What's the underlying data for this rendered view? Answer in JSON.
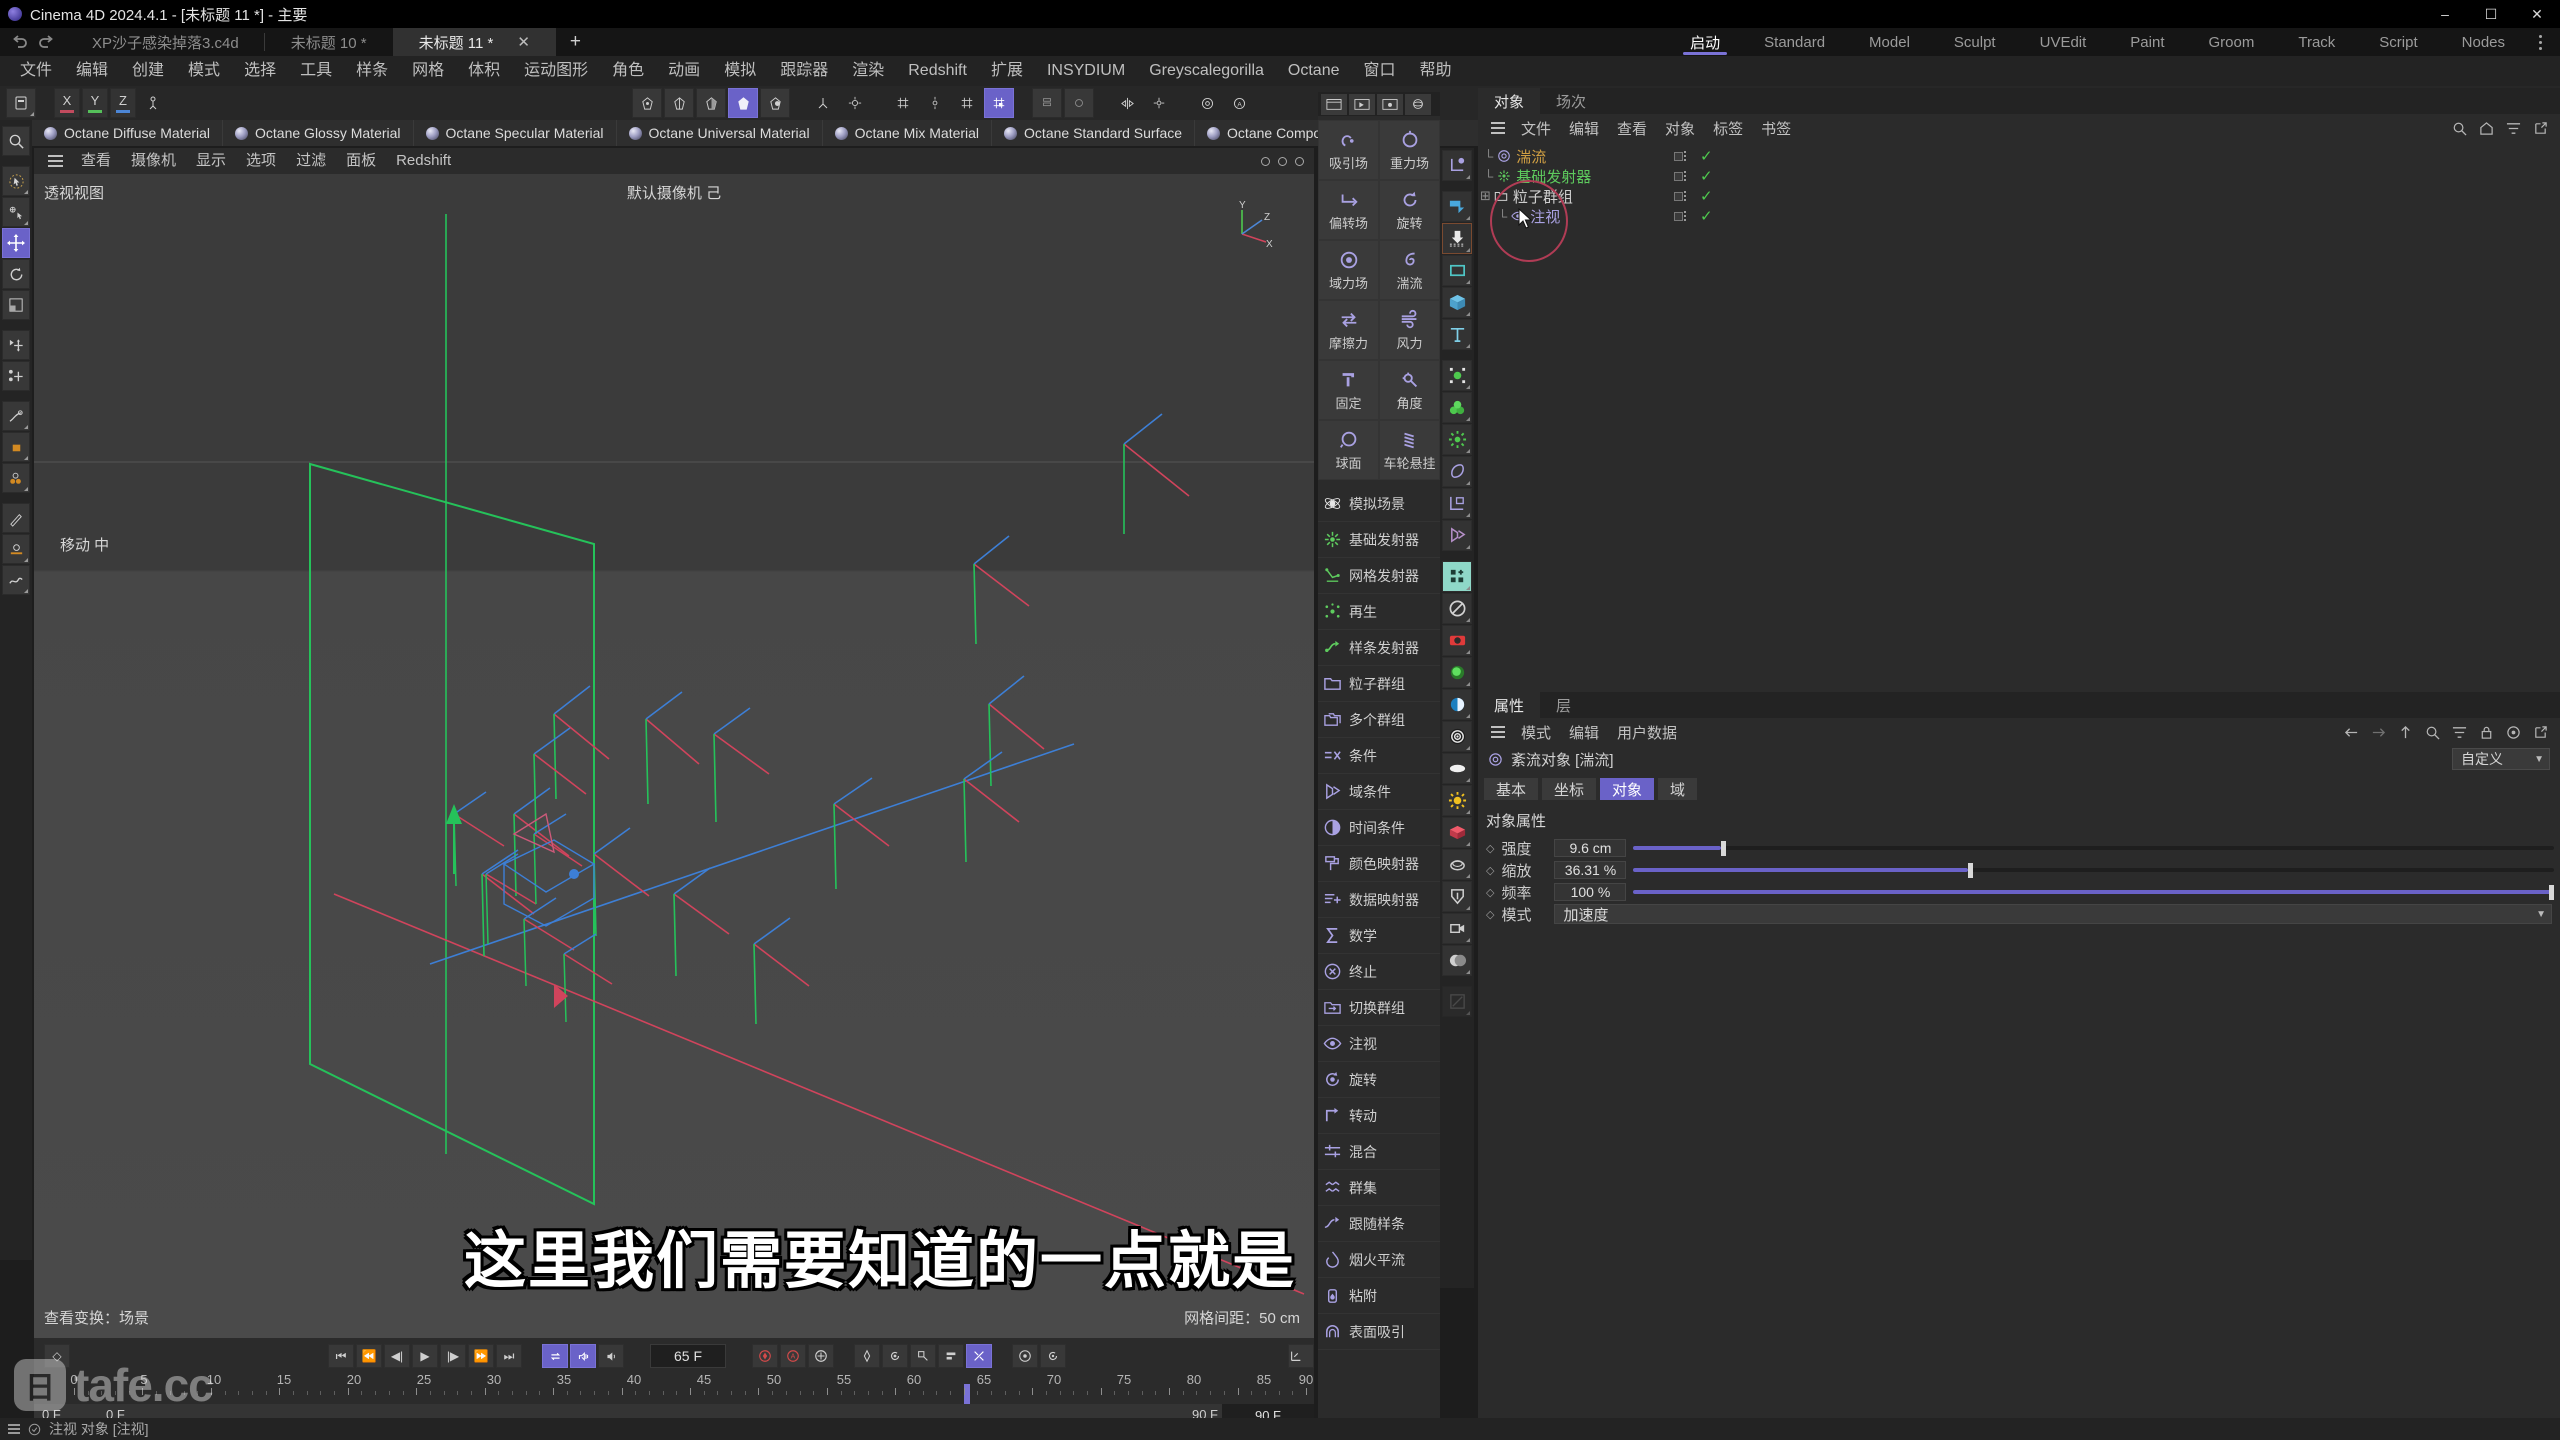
{
  "window": {
    "title": "Cinema 4D 2024.4.1 - [未标题 11 *] - 主要",
    "minimize": "–",
    "maximize": "☐",
    "close": "✕"
  },
  "doc_tabs": {
    "undo": "undo-icon",
    "redo": "redo-icon",
    "items": [
      {
        "label": "XP沙子感染掉落3.c4d",
        "active": false
      },
      {
        "label": "未标题 10 *",
        "active": false
      },
      {
        "label": "未标题 11 *",
        "active": true,
        "close": "✕"
      }
    ],
    "add": "+"
  },
  "layout_tabs": {
    "items": [
      "启动",
      "Standard",
      "Model",
      "Sculpt",
      "UVEdit",
      "Paint",
      "Groom",
      "Track",
      "Script",
      "Nodes"
    ],
    "active": "启动",
    "overflow": "more-icon"
  },
  "menubar": {
    "items": [
      "文件",
      "编辑",
      "创建",
      "模式",
      "选择",
      "工具",
      "样条",
      "网格",
      "体积",
      "运动图形",
      "角色",
      "动画",
      "模拟",
      "跟踪器",
      "渲染",
      "Redshift",
      "扩展",
      "INSYDIUM",
      "Greyscalegorilla",
      "Octane",
      "窗口",
      "帮助"
    ]
  },
  "materials": {
    "items": [
      "Octane Diffuse Material",
      "Octane Glossy Material",
      "Octane Specular Material",
      "Octane Universal Material",
      "Octane Mix Material",
      "Octane Standard Surface",
      "Octane Composite Mate"
    ]
  },
  "viewport": {
    "menu": [
      "查看",
      "摄像机",
      "显示",
      "选项",
      "过滤",
      "面板",
      "Redshift"
    ],
    "view_label": "透视视图",
    "camera_label": "默认摄像机",
    "center_label": "默认摄像机 己",
    "tool_hint": "移动 中",
    "view_transform": "查看变换：场景",
    "grid_spacing": "网格间距：50 cm",
    "axis_x": "X",
    "axis_y": "Y",
    "axis_z": "Z"
  },
  "xp_panel": {
    "tabs": [
      "xp-capture-icon",
      "xp-cache-icon",
      "xp-settings-icon",
      "xp-sphere-icon"
    ],
    "fields": [
      {
        "label": "吸引场",
        "icon": "attractor-icon"
      },
      {
        "label": "重力场",
        "icon": "gravity-icon"
      },
      {
        "label": "偏转场",
        "icon": "deflector-icon"
      },
      {
        "label": "旋转",
        "icon": "rotate-icon"
      },
      {
        "label": "域力场",
        "icon": "field-force-icon"
      },
      {
        "label": "湍流",
        "icon": "turbulence-icon"
      },
      {
        "label": "摩擦力",
        "icon": "friction-icon"
      },
      {
        "label": "风力",
        "icon": "wind-icon"
      },
      {
        "label": "固定",
        "icon": "fixed-icon"
      },
      {
        "label": "角度",
        "icon": "angle-icon"
      },
      {
        "label": "球面",
        "icon": "spherical-icon"
      },
      {
        "label": "车轮悬挂",
        "icon": "wheel-suspension-icon"
      }
    ],
    "list": [
      {
        "label": "模拟场景",
        "icon": "sim-scene-icon",
        "color": "#e6e6e6"
      },
      {
        "label": "基础发射器",
        "icon": "emitter-icon",
        "color": "#5ecb5e"
      },
      {
        "label": "网格发射器",
        "icon": "mesh-emitter-icon",
        "color": "#5ecb5e"
      },
      {
        "label": "再生",
        "icon": "regenerate-icon",
        "color": "#5ecb5e"
      },
      {
        "label": "样条发射器",
        "icon": "spline-emitter-icon",
        "color": "#5ecb5e"
      },
      {
        "label": "粒子群组",
        "icon": "particle-group-icon",
        "color": "#a9a1e2"
      },
      {
        "label": "多个群组",
        "icon": "multi-group-icon",
        "color": "#a9a1e2"
      },
      {
        "label": "条件",
        "icon": "condition-icon",
        "color": "#a9a1e2"
      },
      {
        "label": "域条件",
        "icon": "field-condition-icon",
        "color": "#a9a1e2"
      },
      {
        "label": "时间条件",
        "icon": "time-condition-icon",
        "color": "#a9a1e2"
      },
      {
        "label": "颜色映射器",
        "icon": "color-mapper-icon",
        "color": "#a9a1e2"
      },
      {
        "label": "数据映射器",
        "icon": "data-mapper-icon",
        "color": "#a9a1e2"
      },
      {
        "label": "数学",
        "icon": "math-icon",
        "color": "#a9a1e2"
      },
      {
        "label": "终止",
        "icon": "kill-icon",
        "color": "#a9a1e2"
      },
      {
        "label": "切换群组",
        "icon": "change-group-icon",
        "color": "#a9a1e2"
      },
      {
        "label": "注视",
        "icon": "look-at-icon",
        "color": "#a9a1e2"
      },
      {
        "label": "旋转",
        "icon": "spin-icon",
        "color": "#a9a1e2"
      },
      {
        "label": "转动",
        "icon": "turn-icon",
        "color": "#a9a1e2"
      },
      {
        "label": "混合",
        "icon": "blend-icon",
        "color": "#a9a1e2"
      },
      {
        "label": "群集",
        "icon": "flock-icon",
        "color": "#a9a1e2"
      },
      {
        "label": "跟随样条",
        "icon": "follow-spline-icon",
        "color": "#a9a1e2"
      },
      {
        "label": "烟火平流",
        "icon": "pyro-advection-icon",
        "color": "#a9a1e2"
      },
      {
        "label": "粘附",
        "icon": "stick-icon",
        "color": "#a9a1e2"
      },
      {
        "label": "表面吸引",
        "icon": "surface-attract-icon",
        "color": "#a9a1e2"
      }
    ]
  },
  "object_manager": {
    "tabs": [
      "对象",
      "场次"
    ],
    "active_tab": "对象",
    "menu": [
      "文件",
      "编辑",
      "查看",
      "对象",
      "标签",
      "书签"
    ],
    "right_icons": [
      "search-icon",
      "home-icon",
      "filter-icon",
      "popout-icon"
    ],
    "rows": [
      {
        "name": "湍流",
        "color": "#d1a043",
        "icon": "turbulence-icon",
        "indent": 0,
        "selected": true,
        "visible": true
      },
      {
        "name": "基础发射器",
        "color": "#5ecb5e",
        "icon": "emitter-icon",
        "indent": 0,
        "selected": false,
        "visible": true
      },
      {
        "name": "粒子群组",
        "color": "#cfcfcf",
        "icon": "folder-icon",
        "indent": 0,
        "selected": false,
        "visible": true,
        "expander": "+"
      },
      {
        "name": "注视",
        "color": "#a9a1e2",
        "icon": "look-at-icon",
        "indent": 1,
        "selected": false,
        "visible": true
      }
    ]
  },
  "attributes": {
    "tabs": [
      "属性",
      "层"
    ],
    "active_tab": "属性",
    "menu": [
      "模式",
      "编辑",
      "用户数据"
    ],
    "right_icons": [
      "back-icon",
      "forward-icon",
      "up-icon",
      "search-icon",
      "filter-icon",
      "lock-icon",
      "target-icon",
      "popout-icon"
    ],
    "object_title": "紊流对象 [湍流]",
    "preset": "自定义",
    "tabs_row": [
      "基本",
      "坐标",
      "对象",
      "域"
    ],
    "active_prop_tab": "对象",
    "section_title": "对象属性",
    "properties": [
      {
        "label": "强度",
        "value": "9.6 cm",
        "percent": 9.5
      },
      {
        "label": "缩放",
        "value": "36.31 %",
        "percent": 36.31
      },
      {
        "label": "频率",
        "value": "100 %",
        "percent": 100
      }
    ],
    "mode": {
      "label": "模式",
      "value": "加速度"
    }
  },
  "timeline": {
    "frame_value": "65 F",
    "range_start": "0 F",
    "range_start_field": "0 F",
    "range_end": "90 F",
    "range_end_field": "90 F",
    "ticks": [
      0,
      5,
      10,
      15,
      20,
      25,
      30,
      35,
      40,
      45,
      50,
      55,
      60,
      65,
      70,
      75,
      80,
      85,
      90
    ],
    "current_frame": 65,
    "transport": [
      "go-start-icon",
      "fast-rewind-icon",
      "step-back-icon",
      "play-icon",
      "step-forward-icon",
      "fast-forward-icon",
      "go-end-icon"
    ],
    "toggles": [
      "loop-icon",
      "sound-icon",
      "speaker-icon"
    ],
    "record": [
      "record-icon",
      "autokey-icon",
      "keyframe-selection-icon"
    ],
    "params": [
      "position-icon",
      "rotation-icon",
      "scale-icon",
      "param-icon",
      "pla-icon"
    ],
    "extra": [
      "point-level-icon",
      "animation-icon"
    ]
  },
  "statusbar": {
    "text": "注视 对象 [注视]"
  },
  "subtitle": {
    "text": "这里我们需要知道的一点就是"
  },
  "watermark": {
    "badge": "日",
    "text": "tafe.cc"
  },
  "colors": {
    "accent": "#6a62c8",
    "green_check": "#4ec94e",
    "selection_circle": "#b03c55",
    "panel_bg": "#2b2b2b",
    "viewport_bg": "#3b3b3b"
  }
}
